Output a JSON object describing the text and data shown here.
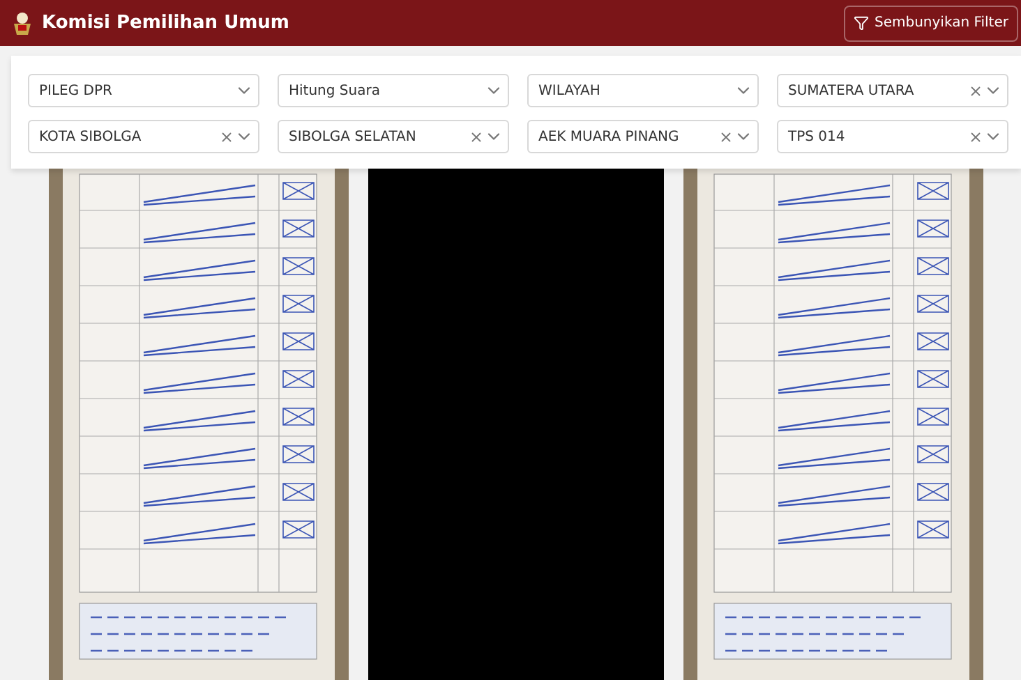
{
  "header": {
    "title": "Komisi Pemilihan Umum",
    "toggle_button": "Sembunyikan Filter"
  },
  "filters": [
    {
      "value": "PILEG DPR",
      "clearable": false
    },
    {
      "value": "Hitung Suara",
      "clearable": false
    },
    {
      "value": "WILAYAH",
      "clearable": false
    },
    {
      "value": "SUMATERA UTARA",
      "clearable": true
    },
    {
      "value": "KOTA SIBOLGA",
      "clearable": true
    },
    {
      "value": "SIBOLGA SELATAN",
      "clearable": true
    },
    {
      "value": "AEK MUARA PINANG",
      "clearable": true
    },
    {
      "value": "TPS 014",
      "clearable": true
    }
  ],
  "documents": [
    {
      "kind": "picture"
    },
    {
      "kind": "blank"
    },
    {
      "kind": "picture"
    }
  ]
}
